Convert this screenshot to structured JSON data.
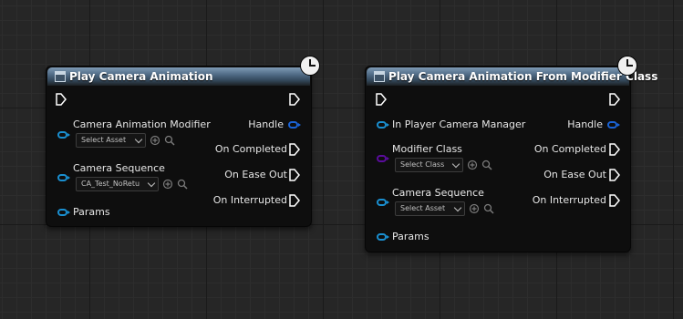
{
  "node1": {
    "title": "Play Camera Animation",
    "inputs": {
      "modifier": "Camera Animation Modifier",
      "modifier_value": "Select Asset",
      "sequence": "Camera Sequence",
      "sequence_value": "CA_Test_NoRetu",
      "params": "Params"
    },
    "outputs": [
      "Handle",
      "On Completed",
      "On Ease Out",
      "On Interrupted"
    ]
  },
  "node2": {
    "title": "Play Camera Animation From Modifier Class",
    "inputs": {
      "player_manager": "In Player Camera Manager",
      "modifier_class": "Modifier Class",
      "modifier_class_value": "Select Class",
      "sequence": "Camera Sequence",
      "sequence_value": "Select Asset",
      "params": "Params"
    },
    "outputs": [
      "Handle",
      "On Completed",
      "On Ease Out",
      "On Interrupted"
    ]
  },
  "colors": {
    "background": "#262626",
    "node_header": "#4f6a84",
    "object_pin": "#1a8fd0",
    "handle_pin": "#1a63d6",
    "class_pin": "#5a0c9c",
    "exec_pin": "#ffffff"
  },
  "icons": {
    "exec": "exec-pin-icon",
    "latent": "clock-icon",
    "node": "function-node-icon",
    "use_selected": "use-selected-asset-icon",
    "browse": "browse-magnifier-icon"
  }
}
